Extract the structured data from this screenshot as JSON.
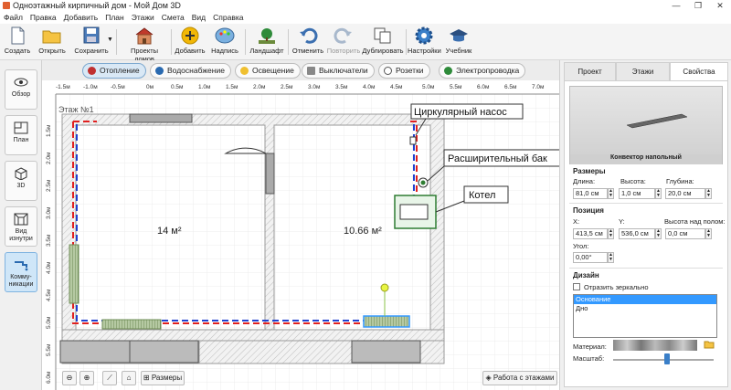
{
  "window": {
    "title": "Одноэтажный кирпичный дом - Мой Дом 3D",
    "minimize": "—",
    "maximize": "❐",
    "close": "✕"
  },
  "menu": [
    "Файл",
    "Правка",
    "Добавить",
    "План",
    "Этажи",
    "Смета",
    "Вид",
    "Справка"
  ],
  "toolbar": {
    "create": "Создать",
    "open": "Открыть",
    "save": "Сохранить",
    "projects": "Проекты домов",
    "add": "Добавить",
    "label": "Надпись",
    "landscape": "Ландшафт",
    "undo": "Отменить",
    "redo": "Повторить",
    "duplicate": "Дублировать",
    "settings": "Настройки",
    "tutorial": "Учебник"
  },
  "left_panel": {
    "overview": "Обзор",
    "plan": "План",
    "view3d": "3D",
    "inside": "Вид изнутри",
    "comms": "Комму-никации"
  },
  "mode_tabs": {
    "heating": "Отопление",
    "water": "Водоснабжение",
    "lighting": "Освещение",
    "switches": "Выключатели",
    "sockets": "Розетки",
    "wiring": "Электропроводка"
  },
  "canvas": {
    "floor_label": "Этаж №1",
    "room1_area": "14 м²",
    "room2_area": "10.66 м²",
    "callout_pump": "Циркулярный насос",
    "callout_tank": "Расширительный бак",
    "callout_boiler": "Котел",
    "ruler_x": [
      "-1.5м",
      "-1.0м",
      "-0.5м",
      "0м",
      "0.5м",
      "1.0м",
      "1.5м",
      "2.0м",
      "2.5м",
      "3.0м",
      "3.5м",
      "4.0м",
      "4.5м",
      "5.0м",
      "5.5м",
      "6.0м",
      "6.5м",
      "7.0м"
    ],
    "ruler_y": [
      "1.5м",
      "2.0м",
      "2.5м",
      "3.0м",
      "3.5м",
      "4.0м",
      "4.5м",
      "5.0м",
      "5.5м",
      "6.0м"
    ],
    "sizes_button": "Размеры",
    "floors_button": "Работа с этажами"
  },
  "right_panel": {
    "tabs": {
      "project": "Проект",
      "floors": "Этажи",
      "properties": "Свойства"
    },
    "preview_caption": "Конвектор напольный",
    "sizes": {
      "title": "Размеры",
      "length_label": "Длина:",
      "length": "81,0 см",
      "height_label": "Высота:",
      "height": "1,0 см",
      "depth_label": "Глубина:",
      "depth": "20,0 см"
    },
    "position": {
      "title": "Позиция",
      "x_label": "X:",
      "x": "413,5 см",
      "y_label": "Y:",
      "y": "536,0 см",
      "elev_label": "Высота над полом:",
      "elev": "0,0 см",
      "angle_label": "Угол:",
      "angle": "0,00°"
    },
    "design": {
      "title": "Дизайн",
      "mirror": "Отразить зеркально",
      "items": [
        "Основание",
        "Дно"
      ],
      "material_label": "Материал:",
      "scale_label": "Масштаб:"
    }
  },
  "colors": {
    "accent": "#3b7fd0",
    "supply": "#e02020",
    "return": "#2040d0",
    "selection": "#3399ff"
  }
}
